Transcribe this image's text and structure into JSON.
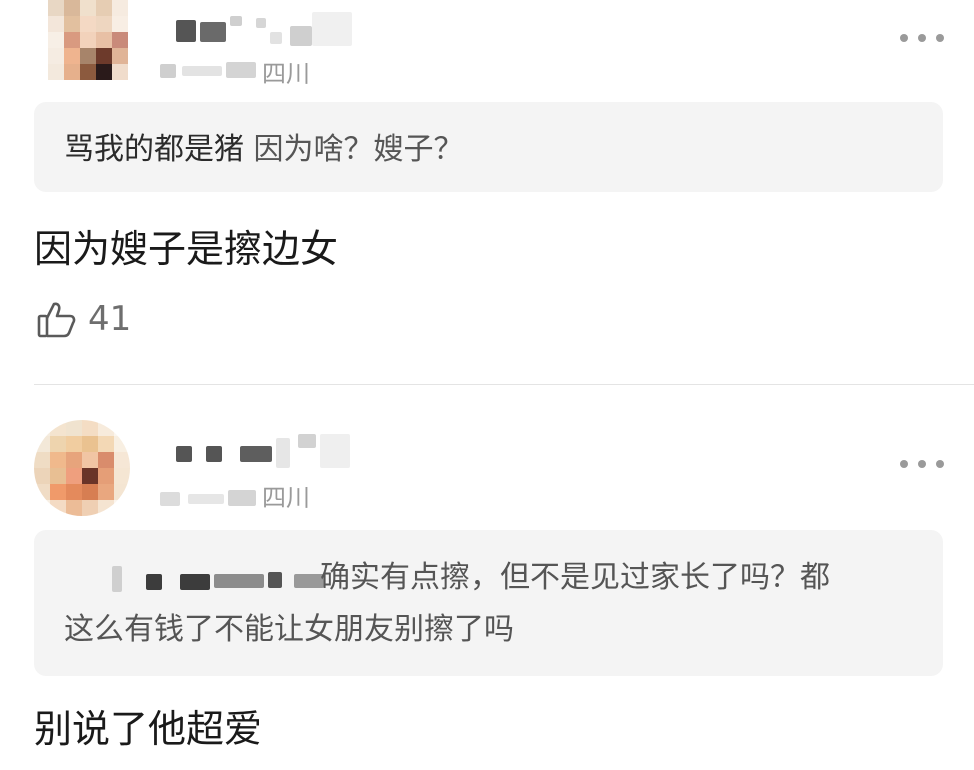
{
  "comments": [
    {
      "location": "四川",
      "quote_author": "骂我的都是猪",
      "quote_text": "因为啥？嫂子？",
      "text": "因为嫂子是擦边女",
      "likes": "41",
      "icons": {
        "more": "more-icon",
        "like": "thumbs-up-icon"
      }
    },
    {
      "location": "四川",
      "quote_text_line1": "确实有点擦，但不是见过家长了吗？都",
      "quote_text_line2": "这么有钱了不能让女朋友别擦了吗",
      "text": "别说了他超爱",
      "icons": {
        "more": "more-icon"
      }
    }
  ],
  "colors": {
    "background": "#ffffff",
    "quote_bg": "#f4f4f4",
    "muted": "#9a9a9a"
  }
}
